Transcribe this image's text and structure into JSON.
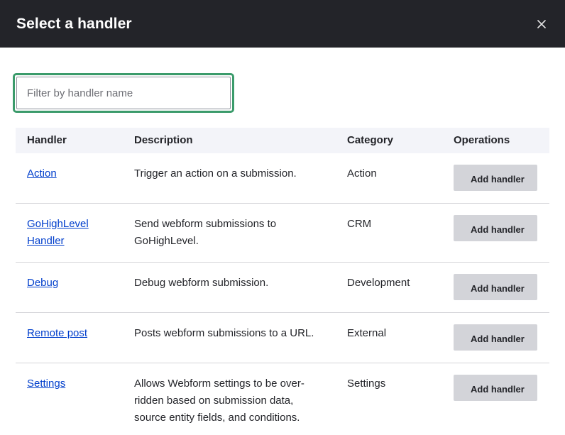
{
  "dialog": {
    "title": "Select a handler",
    "close_icon": "close-icon"
  },
  "filter": {
    "placeholder": "Filter by handler name",
    "value": ""
  },
  "table": {
    "headers": {
      "handler": "Handler",
      "description": "Description",
      "category": "Category",
      "operations": "Operations"
    },
    "rows": [
      {
        "name": "Action",
        "description": "Trigger an action on a submission.",
        "category": "Action",
        "button": "Add handler"
      },
      {
        "name": "GoHighLevel Handler",
        "description": "Send webform submissions to GoHighLevel.",
        "category": "CRM",
        "button": "Add handler"
      },
      {
        "name": "Debug",
        "description": "Debug webform submission.",
        "category": "Development",
        "button": "Add handler"
      },
      {
        "name": "Remote post",
        "description": "Posts webform submissions to a URL.",
        "category": "External",
        "button": "Add handler"
      },
      {
        "name": "Settings",
        "description": "Allows Webform settings to be over-ridden based on submission data, source entity fields, and conditions.",
        "category": "Settings",
        "button": "Add handler"
      }
    ]
  },
  "colors": {
    "titlebar_bg": "#232429",
    "focus_ring": "#3b9b6b",
    "link": "#003ecc",
    "button_bg": "#d3d4d9",
    "header_bg": "#f3f4f9"
  }
}
